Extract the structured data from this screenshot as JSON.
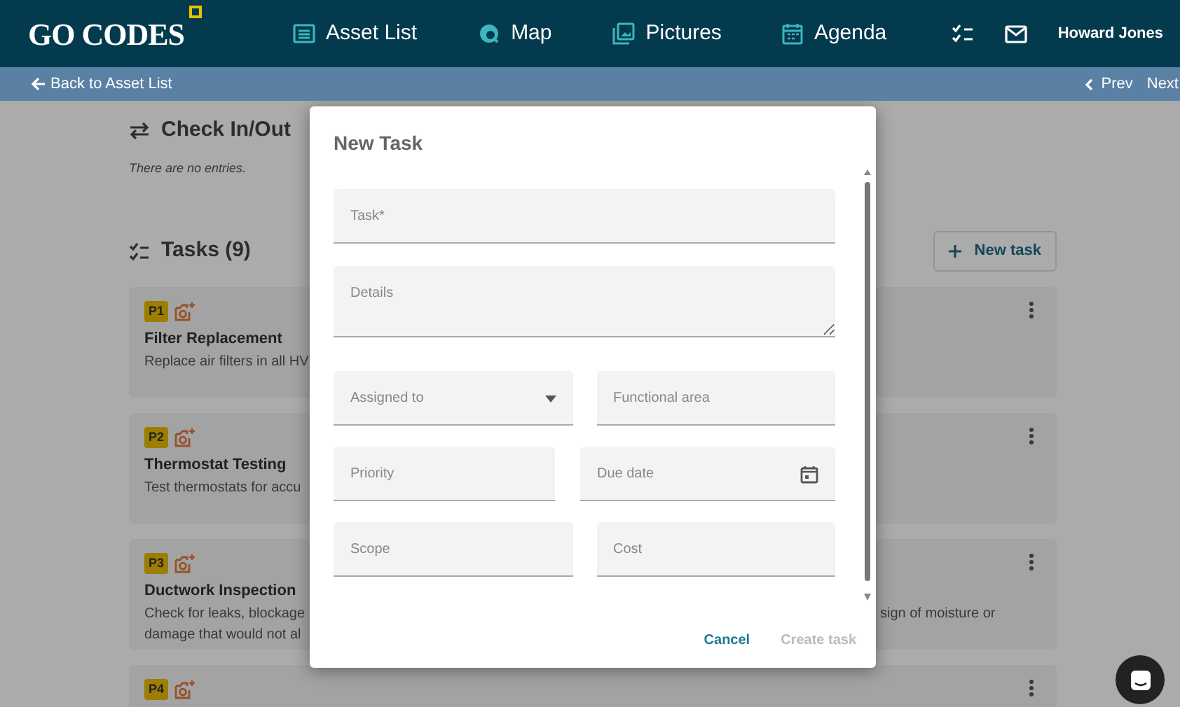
{
  "navbar": {
    "logo": "GO CODES",
    "items": [
      {
        "label": "Asset List"
      },
      {
        "label": "Map"
      },
      {
        "label": "Pictures"
      },
      {
        "label": "Agenda"
      }
    ],
    "user": "Howard Jones"
  },
  "subbar": {
    "back": "Back to Asset List",
    "prev": "Prev",
    "next": "Next"
  },
  "check_in_out": {
    "title": "Check In/Out",
    "empty": "There are no entries."
  },
  "tasks": {
    "title": "Tasks (9)",
    "new_button": "New task",
    "items": [
      {
        "priority": "P1",
        "title": "Filter Replacement",
        "lines": [
          {
            "left": "Replace air filters in all HV"
          }
        ]
      },
      {
        "priority": "P2",
        "title": "Thermostat Testing",
        "lines": [
          {
            "left": "Test thermostats for accu"
          }
        ]
      },
      {
        "priority": "P3",
        "title": "Ductwork Inspection",
        "lines": [
          {
            "left": "Check for leaks, blockage",
            "right": "sign of moisture or"
          },
          {
            "left": "damage that would not al"
          }
        ]
      },
      {
        "priority": "P4"
      }
    ]
  },
  "modal": {
    "title": "New Task",
    "rows": [
      {
        "fields": [
          {
            "kind": "text",
            "placeholder": "Task*"
          }
        ]
      },
      {
        "fields": [
          {
            "kind": "textarea",
            "placeholder": "Details"
          }
        ]
      },
      {
        "fields": [
          {
            "kind": "select",
            "placeholder": "Assigned to"
          },
          {
            "kind": "text",
            "placeholder": "Functional area"
          }
        ]
      },
      {
        "fields": [
          {
            "kind": "text",
            "placeholder": "Priority"
          },
          {
            "kind": "date",
            "placeholder": "Due date"
          }
        ]
      },
      {
        "fields": [
          {
            "kind": "text",
            "placeholder": "Scope"
          },
          {
            "kind": "text",
            "placeholder": "Cost"
          }
        ]
      }
    ],
    "buttons": [
      {
        "label": "Cancel",
        "disabled": false
      },
      {
        "label": "Create task",
        "disabled": true
      }
    ]
  }
}
